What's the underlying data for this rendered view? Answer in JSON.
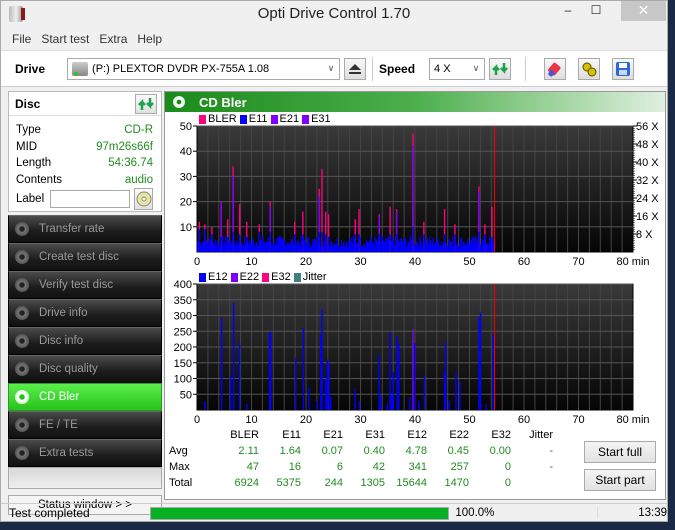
{
  "window": {
    "title": "Opti Drive Control 1.70",
    "min": "–",
    "max": "☐",
    "close": "✕"
  },
  "menu": [
    "File",
    "Start test",
    "Extra",
    "Help"
  ],
  "toolbar": {
    "drive_label": "Drive",
    "drive_value": "(P:)  PLEXTOR DVDR   PX-755A 1.08",
    "speed_label": "Speed",
    "speed_value": "4 X"
  },
  "disc": {
    "title": "Disc",
    "rows": [
      {
        "key": "Type",
        "value": "CD-R"
      },
      {
        "key": "MID",
        "value": "97m26s66f"
      },
      {
        "key": "Length",
        "value": "54:36.74"
      },
      {
        "key": "Contents",
        "value": "audio"
      }
    ],
    "label_key": "Label",
    "label_value": ""
  },
  "nav": [
    {
      "label": "Transfer rate",
      "active": false
    },
    {
      "label": "Create test disc",
      "active": false
    },
    {
      "label": "Verify test disc",
      "active": false
    },
    {
      "label": "Drive info",
      "active": false
    },
    {
      "label": "Disc info",
      "active": false
    },
    {
      "label": "Disc quality",
      "active": false
    },
    {
      "label": "CD Bler",
      "active": true
    },
    {
      "label": "FE / TE",
      "active": false
    },
    {
      "label": "Extra tests",
      "active": false
    }
  ],
  "status_window_label": "Status window > >",
  "panel_title": "CD Bler",
  "colors": {
    "BLER": "#ff0080",
    "E11": "#0000ff",
    "E21": "#8000ff",
    "E31": "#8000ff",
    "E12": "#0000ff",
    "E22": "#8000ff",
    "E32": "#ff0080",
    "Jitter": "#408080",
    "marker": "#ff0000",
    "accent": "#26c21b"
  },
  "chart_data": [
    {
      "type": "bar",
      "title": "",
      "legend": [
        "BLER",
        "E11",
        "E21",
        "E31"
      ],
      "legend_position": "top-left",
      "xlabel": "min",
      "x_ticks": [
        0,
        10,
        20,
        30,
        40,
        50,
        60,
        70,
        80
      ],
      "xlim": [
        0,
        80
      ],
      "y_ticks": [
        10,
        20,
        30,
        40,
        50
      ],
      "ylim": [
        0,
        50
      ],
      "y2_ticks": [
        "8 X",
        "16 X",
        "24 X",
        "32 X",
        "40 X",
        "48 X",
        "56 X"
      ],
      "y2lim": [
        0,
        56
      ],
      "grid": true,
      "end_marker_min": 54.6,
      "spikes": [
        {
          "x": 0.3,
          "BLER": 12,
          "E11": 9
        },
        {
          "x": 1.3,
          "BLER": 11,
          "E11": 9
        },
        {
          "x": 2.6,
          "BLER": 10,
          "E11": 7
        },
        {
          "x": 4.3,
          "BLER": 20,
          "E11": 6,
          "E31": 20
        },
        {
          "x": 5.5,
          "BLER": 13,
          "E11": 6
        },
        {
          "x": 6.5,
          "BLER": 34,
          "E11": 8,
          "E31": 30
        },
        {
          "x": 7.7,
          "BLER": 19,
          "E11": 7
        },
        {
          "x": 9.0,
          "BLER": 12,
          "E11": 6
        },
        {
          "x": 11.3,
          "BLER": 11,
          "E11": 8
        },
        {
          "x": 13.3,
          "BLER": 20,
          "E11": 8,
          "E31": 18
        },
        {
          "x": 17.8,
          "BLER": 12,
          "E11": 7
        },
        {
          "x": 19.3,
          "BLER": 16,
          "E11": 7
        },
        {
          "x": 22.3,
          "BLER": 25,
          "E11": 8,
          "E31": 22
        },
        {
          "x": 22.8,
          "BLER": 33,
          "E11": 8
        },
        {
          "x": 23.5,
          "BLER": 16,
          "E11": 7
        },
        {
          "x": 24.0,
          "BLER": 15,
          "E11": 6
        },
        {
          "x": 28.9,
          "BLER": 13,
          "E11": 7
        },
        {
          "x": 29.6,
          "BLER": 17,
          "E11": 7
        },
        {
          "x": 33.3,
          "BLER": 15,
          "E11": 7,
          "E31": 14
        },
        {
          "x": 35.3,
          "BLER": 18,
          "E11": 7
        },
        {
          "x": 36.5,
          "BLER": 17,
          "E11": 7,
          "E31": 16
        },
        {
          "x": 39.5,
          "BLER": 47,
          "E11": 10,
          "E31": 42
        },
        {
          "x": 41.5,
          "BLER": 12,
          "E11": 7
        },
        {
          "x": 45.3,
          "BLER": 17,
          "E11": 7
        },
        {
          "x": 47.2,
          "BLER": 11,
          "E11": 7
        },
        {
          "x": 51.6,
          "BLER": 26,
          "E11": 8,
          "E31": 24
        },
        {
          "x": 52.7,
          "BLER": 11,
          "E11": 7
        },
        {
          "x": 54.0,
          "BLER": 18,
          "E11": 6
        }
      ]
    },
    {
      "type": "bar",
      "title": "",
      "legend": [
        "E12",
        "E22",
        "E32",
        "Jitter"
      ],
      "legend_position": "top-left",
      "xlabel": "min",
      "x_ticks": [
        0,
        10,
        20,
        30,
        40,
        50,
        60,
        70,
        80
      ],
      "xlim": [
        0,
        80
      ],
      "y_ticks": [
        50,
        100,
        150,
        200,
        250,
        300,
        350,
        400
      ],
      "ylim": [
        0,
        400
      ],
      "grid": true,
      "end_marker_min": 54.6,
      "spikes": [
        {
          "x": 1.3,
          "E12": 28
        },
        {
          "x": 4.4,
          "E12": 292
        },
        {
          "x": 6.0,
          "E12": 110
        },
        {
          "x": 6.6,
          "E12": 341
        },
        {
          "x": 7.7,
          "E12": 212
        },
        {
          "x": 9.0,
          "E12": 20
        },
        {
          "x": 13.2,
          "E12": 248
        },
        {
          "x": 13.4,
          "E12": 248
        },
        {
          "x": 18.0,
          "E12": 165
        },
        {
          "x": 19.4,
          "E12": 260
        },
        {
          "x": 20.4,
          "E12": 72
        },
        {
          "x": 21.9,
          "E12": 28
        },
        {
          "x": 22.6,
          "E12": 240
        },
        {
          "x": 22.8,
          "E12": 320
        },
        {
          "x": 23.5,
          "E12": 100
        },
        {
          "x": 23.8,
          "E12": 160
        },
        {
          "x": 24.1,
          "E12": 150
        },
        {
          "x": 24.4,
          "E12": 42
        },
        {
          "x": 28.9,
          "E12": 68
        },
        {
          "x": 29.7,
          "E12": 28
        },
        {
          "x": 33.3,
          "E12": 175
        },
        {
          "x": 33.6,
          "E12": 48
        },
        {
          "x": 34.8,
          "E12": 20
        },
        {
          "x": 35.3,
          "E12": 248
        },
        {
          "x": 35.6,
          "E12": 48
        },
        {
          "x": 35.9,
          "E12": 120
        },
        {
          "x": 36.6,
          "E12": 235
        },
        {
          "x": 36.9,
          "E12": 212
        },
        {
          "x": 38.9,
          "E12": 40
        },
        {
          "x": 39.5,
          "E22": 257
        },
        {
          "x": 39.8,
          "E12": 212
        },
        {
          "x": 40.6,
          "E12": 30
        },
        {
          "x": 41.6,
          "E12": 110
        },
        {
          "x": 45.3,
          "E12": 120
        },
        {
          "x": 45.5,
          "E12": 215
        },
        {
          "x": 46.2,
          "E12": 30
        },
        {
          "x": 47.4,
          "E12": 120
        },
        {
          "x": 48.1,
          "E12": 90
        },
        {
          "x": 51.6,
          "E12": 295
        },
        {
          "x": 51.9,
          "E12": 310
        },
        {
          "x": 52.9,
          "E12": 18
        },
        {
          "x": 54.2,
          "E12": 240
        }
      ]
    },
    {
      "type": "table",
      "columns": [
        "",
        "BLER",
        "E11",
        "E21",
        "E31",
        "E12",
        "E22",
        "E32",
        "Jitter"
      ],
      "rows": [
        [
          "Avg",
          "2.11",
          "1.64",
          "0.07",
          "0.40",
          "4.78",
          "0.45",
          "0.00",
          "-"
        ],
        [
          "Max",
          "47",
          "16",
          "6",
          "42",
          "341",
          "257",
          "0",
          "-"
        ],
        [
          "Total",
          "6924",
          "5375",
          "244",
          "1305",
          "15644",
          "1470",
          "0",
          ""
        ]
      ]
    }
  ],
  "buttons": {
    "start_full": "Start full",
    "start_part": "Start part"
  },
  "status": {
    "text": "Test completed",
    "progress": 1.0,
    "progress_label": "100.0%",
    "time": "13:39"
  }
}
